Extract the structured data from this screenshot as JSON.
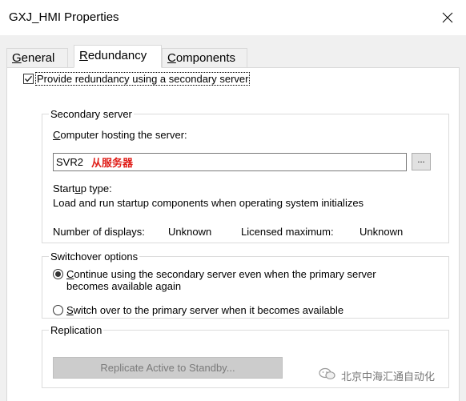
{
  "window": {
    "title": "GXJ_HMI Properties"
  },
  "tabs": [
    {
      "label": "General",
      "mnemonic": "G",
      "rest": "eneral"
    },
    {
      "label": "Redundancy",
      "mnemonic": "R",
      "rest": "edundancy"
    },
    {
      "label": "Components",
      "mnemonic": "C",
      "rest": "omponents"
    }
  ],
  "redundancy": {
    "provide_checkbox": {
      "label": "Provide redundancy using a secondary server",
      "checked": true
    },
    "secondary_server": {
      "legend": "Secondary server",
      "computer_label_mn": "C",
      "computer_label_rest": "omputer hosting the server:",
      "computer_value": "SVR2",
      "annotation": "从服务器",
      "annotation_color": "#e0201b",
      "browse_label": "...",
      "startup_label_pre": "Start",
      "startup_label_mn": "u",
      "startup_label_post": "p type:",
      "startup_value": "Load and run startup components when operating system initializes",
      "displays_label": "Number of displays:",
      "displays_value": "Unknown",
      "licensed_label": "Licensed maximum:",
      "licensed_value": "Unknown"
    },
    "switchover": {
      "legend": "Switchover options",
      "option1_mn": "C",
      "option1_line1_rest": "ontinue using the secondary server even when the primary server",
      "option1_line2": "becomes available again",
      "option1_selected": true,
      "option2_mn": "S",
      "option2_rest": "witch over to the primary server when it becomes available",
      "option2_selected": false
    },
    "replication": {
      "legend": "Replication",
      "button_label": "Replicate Active to Standby..."
    }
  },
  "watermark": {
    "text": "北京中海汇通自动化",
    "icon": "wechat-icon"
  }
}
